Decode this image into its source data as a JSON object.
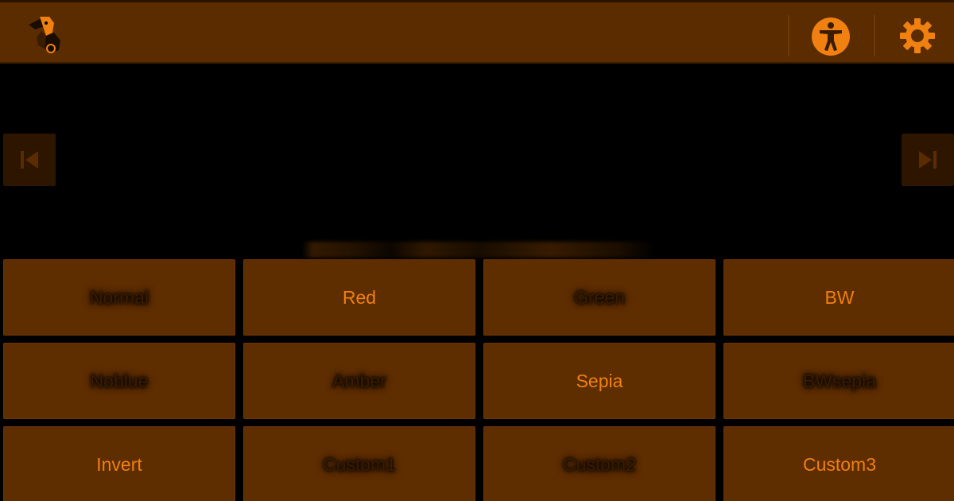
{
  "colors": {
    "accent": "#f08010",
    "bar_background": "#5a2c00",
    "button_background": "#5e2d00",
    "screen_background": "#000000"
  },
  "toolbar": {
    "app_icon": "chameleon-logo-icon",
    "accessibility_icon": "accessibility-icon",
    "settings_icon": "gear-icon"
  },
  "navigation": {
    "prev_icon": "skip-previous-icon",
    "next_icon": "skip-next-icon"
  },
  "filters": [
    {
      "label": "Normal",
      "state": "dim"
    },
    {
      "label": "Red",
      "state": "lit"
    },
    {
      "label": "Green",
      "state": "dim"
    },
    {
      "label": "BW",
      "state": "lit"
    },
    {
      "label": "Noblue",
      "state": "dim"
    },
    {
      "label": "Amber",
      "state": "dim"
    },
    {
      "label": "Sepia",
      "state": "lit"
    },
    {
      "label": "BWsepia",
      "state": "dim"
    },
    {
      "label": "Invert",
      "state": "lit"
    },
    {
      "label": "Custom1",
      "state": "dim"
    },
    {
      "label": "Custom2",
      "state": "dim"
    },
    {
      "label": "Custom3",
      "state": "lit"
    }
  ]
}
